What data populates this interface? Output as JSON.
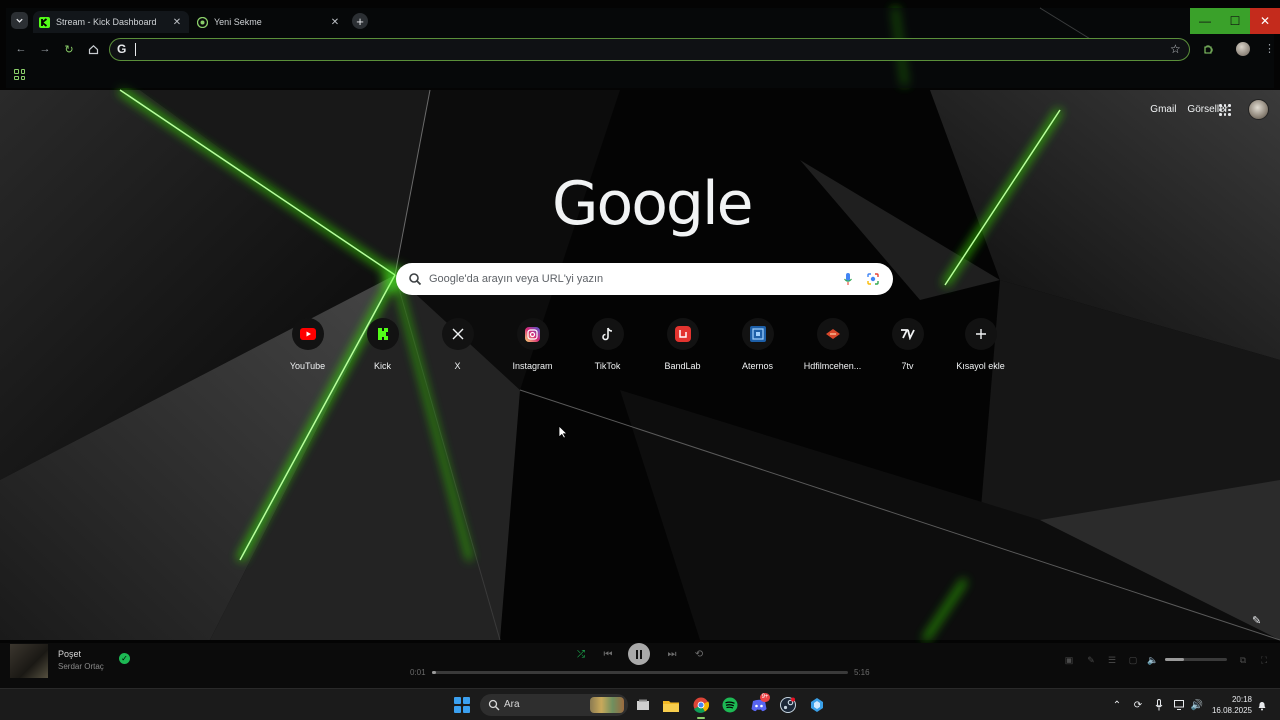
{
  "browser": {
    "tabs": [
      {
        "title": "Stream - Kick Dashboard",
        "active": true
      },
      {
        "title": "Yeni Sekme",
        "active": false
      }
    ],
    "omnibox": {
      "value": ""
    },
    "accent": "#53fc18"
  },
  "ntp": {
    "header_links": [
      "Gmail",
      "Görseller"
    ],
    "logo": "Google",
    "search_placeholder": "Google'da arayın veya URL'yi yazın",
    "shortcuts": [
      {
        "label": "YouTube",
        "icon": "youtube-icon"
      },
      {
        "label": "Kick",
        "icon": "kick-icon"
      },
      {
        "label": "X",
        "icon": "x-icon"
      },
      {
        "label": "Instagram",
        "icon": "instagram-icon"
      },
      {
        "label": "TikTok",
        "icon": "tiktok-icon"
      },
      {
        "label": "BandLab",
        "icon": "bandlab-icon"
      },
      {
        "label": "Aternos",
        "icon": "aternos-icon"
      },
      {
        "label": "Hdfilmcehen...",
        "icon": "hdfilm-icon"
      },
      {
        "label": "7tv",
        "icon": "7tv-icon"
      },
      {
        "label": "Kısayol ekle",
        "icon": "plus-icon"
      }
    ]
  },
  "player": {
    "song": "Poşet",
    "artist": "Serdar Ortaç",
    "elapsed": "0:01",
    "duration": "5:16",
    "progress": 0.003,
    "volume": 0.3
  },
  "taskbar": {
    "search_label": "Ara",
    "time": "20:18",
    "date": "16.08.2025",
    "discord_badge": "9+"
  }
}
